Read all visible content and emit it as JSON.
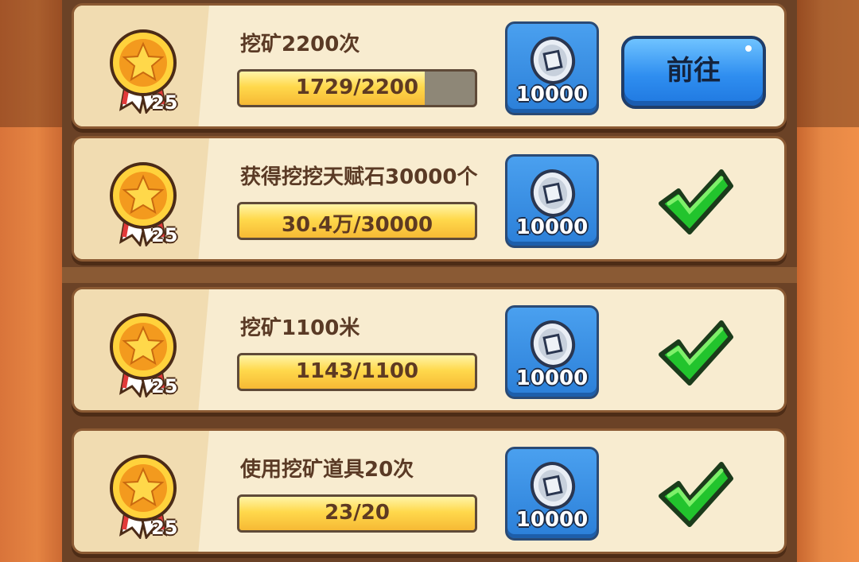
{
  "tasks": [
    {
      "title": "挖矿2200次",
      "medal_count": "25",
      "progress_text": "1729/2200",
      "progress": 0.786,
      "reward_amount": "10000",
      "status": "go",
      "action_label": "前往"
    },
    {
      "title": "获得挖挖天赋石30000个",
      "medal_count": "25",
      "progress_text": "30.4万/30000",
      "progress": 1.0,
      "reward_amount": "10000",
      "status": "done"
    },
    {
      "title": "挖矿1100米",
      "medal_count": "25",
      "progress_text": "1143/1100",
      "progress": 1.0,
      "reward_amount": "10000",
      "status": "done"
    },
    {
      "title": "使用挖矿道具20次",
      "medal_count": "25",
      "progress_text": "23/20",
      "progress": 1.0,
      "reward_amount": "10000",
      "status": "done"
    }
  ],
  "icons": {
    "medal": "star-medal-icon",
    "reward": "silver-coin-icon",
    "done": "checkmark-icon"
  },
  "colors": {
    "progress_fill": "#f6b935",
    "button_blue": "#2f8ef0",
    "check_green": "#22c42d",
    "card_bg": "#f8ecd0"
  }
}
